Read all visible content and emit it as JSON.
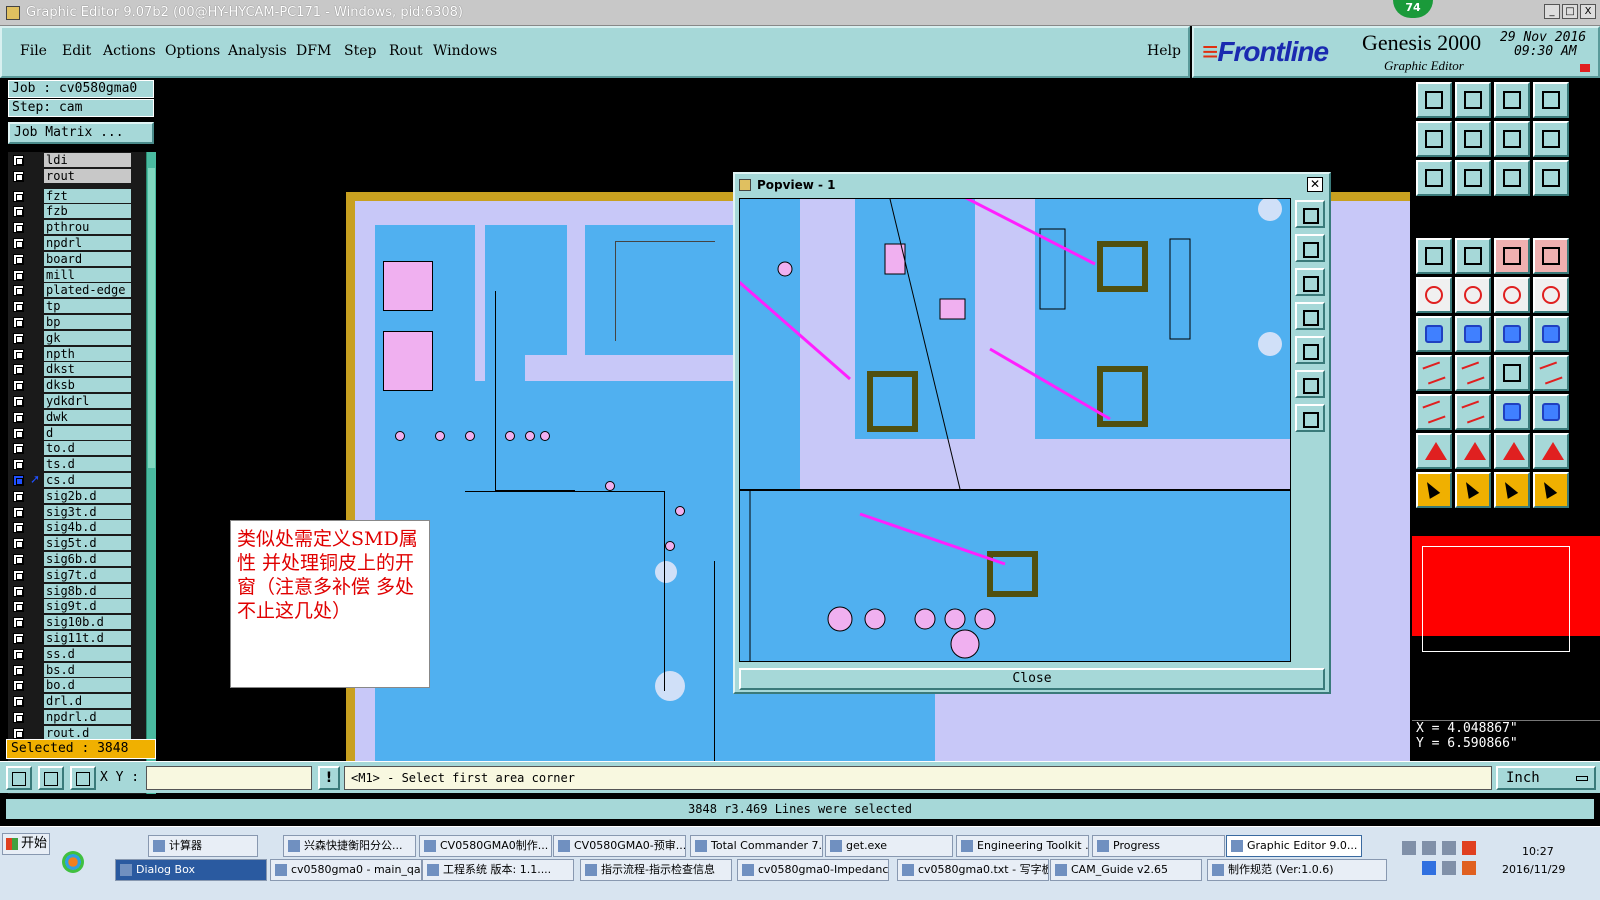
{
  "window": {
    "title": "Graphic Editor 9.07b2 (00@HY-HYCAM-PC171 - Windows, pid:6308)",
    "badge": "74",
    "buttons": [
      "_",
      "□",
      "X"
    ]
  },
  "menu": {
    "items": [
      "File",
      "Edit",
      "Actions",
      "Options",
      "Analysis",
      "DFM",
      "Step",
      "Rout",
      "Windows"
    ],
    "help": "Help"
  },
  "brand": {
    "logo": "Frontline",
    "product": "Genesis 2000",
    "subtitle": "Graphic Editor",
    "date": "29 Nov 2016",
    "time": "09:30 AM"
  },
  "job": {
    "job_label": "Job : cv0580gma0",
    "step_label": "Step: cam",
    "matrix_button": "Job Matrix ..."
  },
  "layers": [
    "ldi",
    "rout",
    "fzt",
    "fzb",
    "pthrou",
    "npdrl",
    "board",
    "mill",
    "plated-edge",
    "tp",
    "bp",
    "gk",
    "npth",
    "dkst",
    "dksb",
    "ydkdrl",
    "dwk",
    "d",
    "to.d",
    "ts.d",
    "cs.d",
    "sig2b.d",
    "sig3t.d",
    "sig4b.d",
    "sig5t.d",
    "sig6b.d",
    "sig7t.d",
    "sig8b.d",
    "sig9t.d",
    "sig10b.d",
    "sig11t.d",
    "ss.d",
    "bs.d",
    "bo.d",
    "drl.d",
    "npdrl.d",
    "rout.d"
  ],
  "active_layer": "cs.d",
  "selected": "Selected : 3848",
  "annotation": "类似处需定义SMD属性  并处理铜皮上的开窗（注意多补偿  多处不止这几处）",
  "popview": {
    "title": "Popview - 1",
    "close": "Close"
  },
  "coords": {
    "x": "X = 4.048867\"",
    "y": "Y = 6.590866\""
  },
  "command": {
    "xy_label": "X Y :",
    "xy_value": "",
    "prompt": "<M1> - Select first area corner",
    "units": "Inch"
  },
  "status": "3848 r3.469 Lines were selected",
  "taskbar": {
    "start": "开始",
    "row1": [
      "计算器",
      "兴森快捷衡阳分公...",
      "CV0580GMA0制作...",
      "CV0580GMA0-预审...",
      "Total Commander 7...",
      "get.exe",
      "Engineering Toolkit ...",
      "Progress",
      "Graphic Editor 9.0..."
    ],
    "row2": [
      "Dialog Box",
      "cv0580gma0 - main_qa",
      "工程系统  版本: 1.1....",
      "指示流程-指示检查信息",
      "cv0580gma0-Impedance...",
      "cv0580gma0.txt - 写字板",
      "CAM_Guide v2.65",
      "制作规范 (Ver:1.0.6)"
    ],
    "clock_time": "10:27",
    "clock_date": "2016/11/29"
  },
  "colors": {
    "panel": "#a6d8d8",
    "board": "#c8c8f8",
    "copper": "#50b0f0",
    "pads": "#f0b0f0",
    "arrow": "#ff20ff",
    "annotation_text": "#e00000",
    "selected_bg": "#f0b000"
  },
  "right_tool_icons": [
    "open-job-icon",
    "save-icon",
    "home-icon",
    "window-icon",
    "zoom-in-icon",
    "zoom-out-icon",
    "fit-icon",
    "scale-1-2-icon",
    "zoom-all-icon",
    "pan-icon",
    "1-2-icon",
    "help-icon",
    "ruler-icon",
    "grid-icon",
    "snap-icon",
    "snap-net-icon",
    "circle-icon",
    "redline-icon",
    "measure-icon",
    "dot-icon",
    "net-icon",
    "cross-icon",
    "line-node-icon",
    "arc-node-icon",
    "edit-line-icon",
    "line-icon",
    "rotate-icon",
    "split-icon",
    "move-point-icon",
    "delete-line-icon",
    "resize-icon",
    "layers-icon",
    "triangle-icon",
    "triangle-a-icon",
    "text-a-icon",
    "triangle-edit-icon",
    "select-arrow-icon",
    "select-box-icon",
    "select-orange-icon",
    "select-net-icon"
  ]
}
